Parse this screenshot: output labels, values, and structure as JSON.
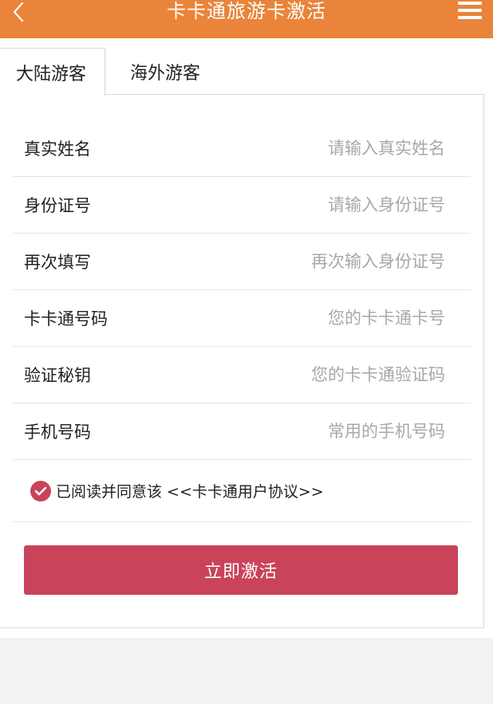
{
  "header": {
    "title": "卡卡通旅游卡激活",
    "back_icon": "chevron-left-icon",
    "menu_icon": "hamburger-menu-icon",
    "background_color": "#e9843a"
  },
  "tabs": [
    {
      "label": "大陆游客",
      "active": true
    },
    {
      "label": "海外游客",
      "active": false
    }
  ],
  "form": {
    "fields": [
      {
        "label": "真实姓名",
        "placeholder": "请输入真实姓名",
        "value": ""
      },
      {
        "label": "身份证号",
        "placeholder": "请输入身份证号",
        "value": ""
      },
      {
        "label": "再次填写",
        "placeholder": "再次输入身份证号",
        "value": ""
      },
      {
        "label": "卡卡通号码",
        "placeholder": "您的卡卡通卡号",
        "value": ""
      },
      {
        "label": "验证秘钥",
        "placeholder": "您的卡卡通验证码",
        "value": ""
      },
      {
        "label": "手机号码",
        "placeholder": "常用的手机号码",
        "value": ""
      }
    ],
    "agreement": {
      "checked": true,
      "text": "已阅读并同意该 <<卡卡通用户协议>>"
    },
    "submit_label": "立即激活",
    "accent_color": "#c9435a"
  }
}
